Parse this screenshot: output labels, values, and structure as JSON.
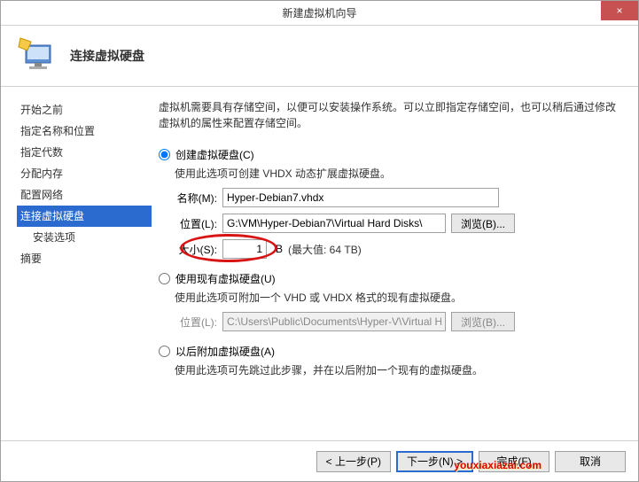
{
  "window": {
    "title": "新建虚拟机向导",
    "close_label": "×"
  },
  "header": {
    "title": "连接虚拟硬盘"
  },
  "sidebar": {
    "items": [
      {
        "label": "开始之前"
      },
      {
        "label": "指定名称和位置"
      },
      {
        "label": "指定代数"
      },
      {
        "label": "分配内存"
      },
      {
        "label": "配置网络"
      },
      {
        "label": "连接虚拟硬盘"
      },
      {
        "label": "安装选项"
      },
      {
        "label": "摘要"
      }
    ]
  },
  "main": {
    "intro": "虚拟机需要具有存储空间，以便可以安装操作系统。可以立即指定存储空间，也可以稍后通过修改虚拟机的属性来配置存储空间。",
    "opt_create": {
      "label": "创建虚拟硬盘(C)",
      "desc": "使用此选项可创建 VHDX 动态扩展虚拟硬盘。",
      "name_label": "名称(M):",
      "name_value": "Hyper-Debian7.vhdx",
      "loc_label": "位置(L):",
      "loc_value": "G:\\VM\\Hyper-Debian7\\Virtual Hard Disks\\",
      "browse_label": "浏览(B)...",
      "size_label": "大小(S):",
      "size_value": "1",
      "size_unit": "B",
      "size_max": "(最大值: 64 TB)"
    },
    "opt_existing": {
      "label": "使用现有虚拟硬盘(U)",
      "desc": "使用此选项可附加一个 VHD 或 VHDX 格式的现有虚拟硬盘。",
      "loc_label": "位置(L):",
      "loc_value": "C:\\Users\\Public\\Documents\\Hyper-V\\Virtual Hard Disks\\",
      "browse_label": "浏览(B)..."
    },
    "opt_later": {
      "label": "以后附加虚拟硬盘(A)",
      "desc": "使用此选项可先跳过此步骤，并在以后附加一个现有的虚拟硬盘。"
    }
  },
  "footer": {
    "prev": "< 上一步(P)",
    "next": "下一步(N) >",
    "finish": "完成(F)",
    "cancel": "取消"
  },
  "watermark": "youxiaxiazai.com"
}
